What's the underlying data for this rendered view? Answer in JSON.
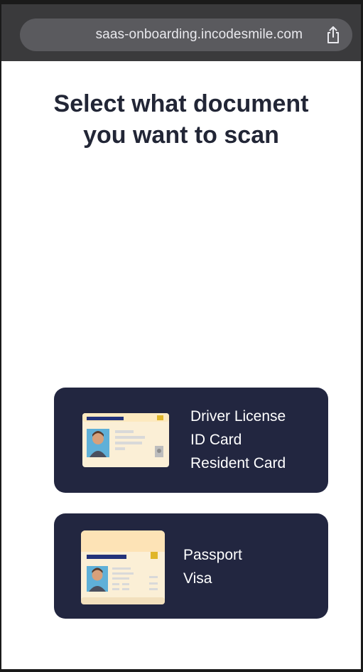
{
  "browser": {
    "url": "saas-onboarding.incodesmile.com",
    "icons": {
      "share": "share-icon"
    }
  },
  "page": {
    "title_line_1": "Select what document",
    "title_line_2": "you want to scan"
  },
  "options": [
    {
      "icon": "id-card-illustration",
      "labels": [
        "Driver License",
        "ID Card",
        "Resident Card"
      ]
    },
    {
      "icon": "passport-illustration",
      "labels": [
        "Passport",
        "Visa"
      ]
    }
  ],
  "colors": {
    "card_background": "#222640",
    "title_text": "#222636",
    "browser_bar": "#3a3a3c",
    "accent_gold": "#e0b62a",
    "accent_navy": "#23337a"
  }
}
